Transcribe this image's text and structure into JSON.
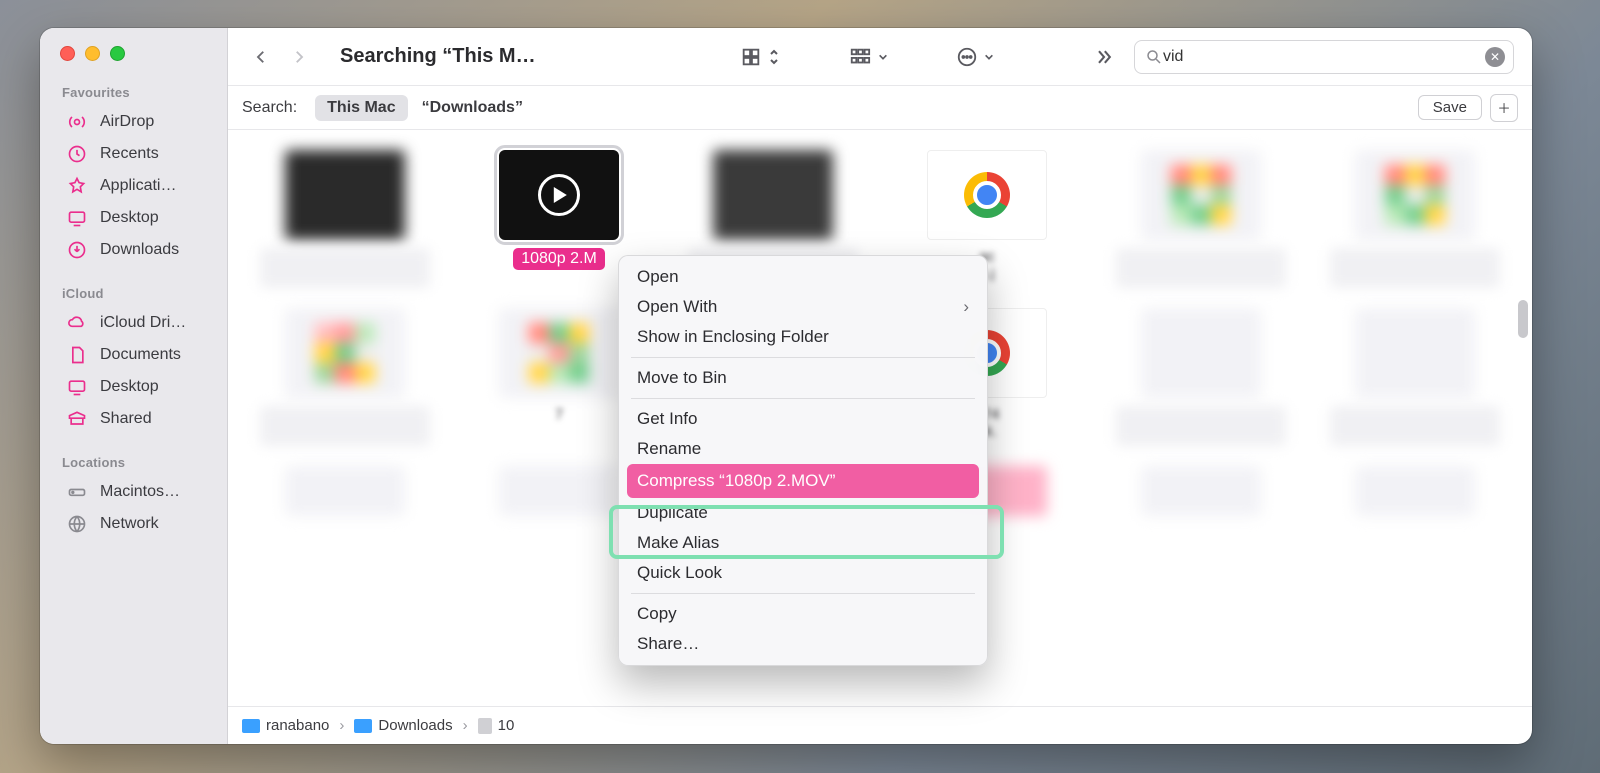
{
  "window": {
    "title": "Searching “This M…"
  },
  "sidebar": {
    "sections": [
      {
        "title": "Favourites",
        "items": [
          {
            "icon": "airdrop-icon",
            "label": "AirDrop"
          },
          {
            "icon": "recents-icon",
            "label": "Recents"
          },
          {
            "icon": "apps-icon",
            "label": "Applicati…"
          },
          {
            "icon": "desktop-icon",
            "label": "Desktop"
          },
          {
            "icon": "downloads-icon",
            "label": "Downloads"
          }
        ]
      },
      {
        "title": "iCloud",
        "items": [
          {
            "icon": "icloud-icon",
            "label": "iCloud Dri…"
          },
          {
            "icon": "documents-icon",
            "label": "Documents"
          },
          {
            "icon": "desktop-icon",
            "label": "Desktop"
          },
          {
            "icon": "shared-icon",
            "label": "Shared"
          }
        ]
      },
      {
        "title": "Locations",
        "items": [
          {
            "icon": "disk-icon",
            "label": "Macintos…"
          },
          {
            "icon": "network-icon",
            "label": "Network"
          }
        ]
      }
    ]
  },
  "search": {
    "value": "vid",
    "label": "Search:"
  },
  "scope": {
    "this_mac": "This Mac",
    "downloads": "“Downloads”",
    "save": "Save"
  },
  "selected_file": {
    "caption": "1080p 2.M"
  },
  "context_menu": {
    "open": "Open",
    "open_with": "Open With",
    "show_enc": "Show in Enclosing Folder",
    "move_bin": "Move to Bin",
    "get_info": "Get Info",
    "rename": "Rename",
    "compress": "Compress “1080p 2.MOV”",
    "duplicate": "Duplicate",
    "make_alias": "Make Alias",
    "quick_look": "Quick Look",
    "copy": "Copy",
    "share": "Share…"
  },
  "pathbar": {
    "c1": "ranabano",
    "c2": "Downloads",
    "c3": "10"
  },
  "grid_hint": {
    "ext1": "ac",
    "ext2": "k.j",
    "ext3": "7",
    "ext4": "174",
    "ext5": "nk."
  }
}
